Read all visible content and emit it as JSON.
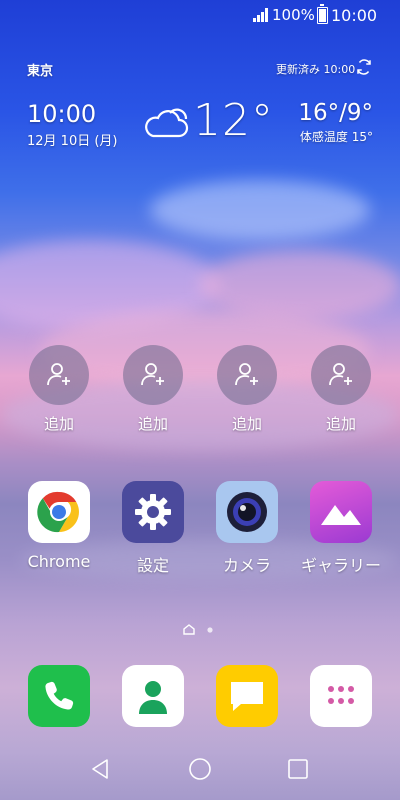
{
  "status_bar": {
    "battery_percent": "100%",
    "time": "10:00"
  },
  "weather": {
    "city": "東京",
    "updated": "更新済み 10:00",
    "time": "10:00",
    "date": "12月 10日 (月)",
    "temperature": "12°",
    "high_low": "16°/9°",
    "feels_like": "体感温度 15°"
  },
  "shortcuts": [
    {
      "label": "追加"
    },
    {
      "label": "追加"
    },
    {
      "label": "追加"
    },
    {
      "label": "追加"
    }
  ],
  "apps": [
    {
      "label": "Chrome",
      "icon": "chrome-icon"
    },
    {
      "label": "設定",
      "icon": "gear-icon"
    },
    {
      "label": "カメラ",
      "icon": "camera-icon"
    },
    {
      "label": "ギャラリー",
      "icon": "gallery-icon"
    }
  ],
  "dock": [
    {
      "icon": "phone-icon",
      "color": "#1fbf4c"
    },
    {
      "icon": "contacts-icon",
      "color": "#ffffff"
    },
    {
      "icon": "messages-icon",
      "color": "#ffcc00"
    },
    {
      "icon": "app-drawer-icon",
      "color": "#ffffff"
    }
  ],
  "pager": {
    "pages": 2,
    "current": 1
  }
}
